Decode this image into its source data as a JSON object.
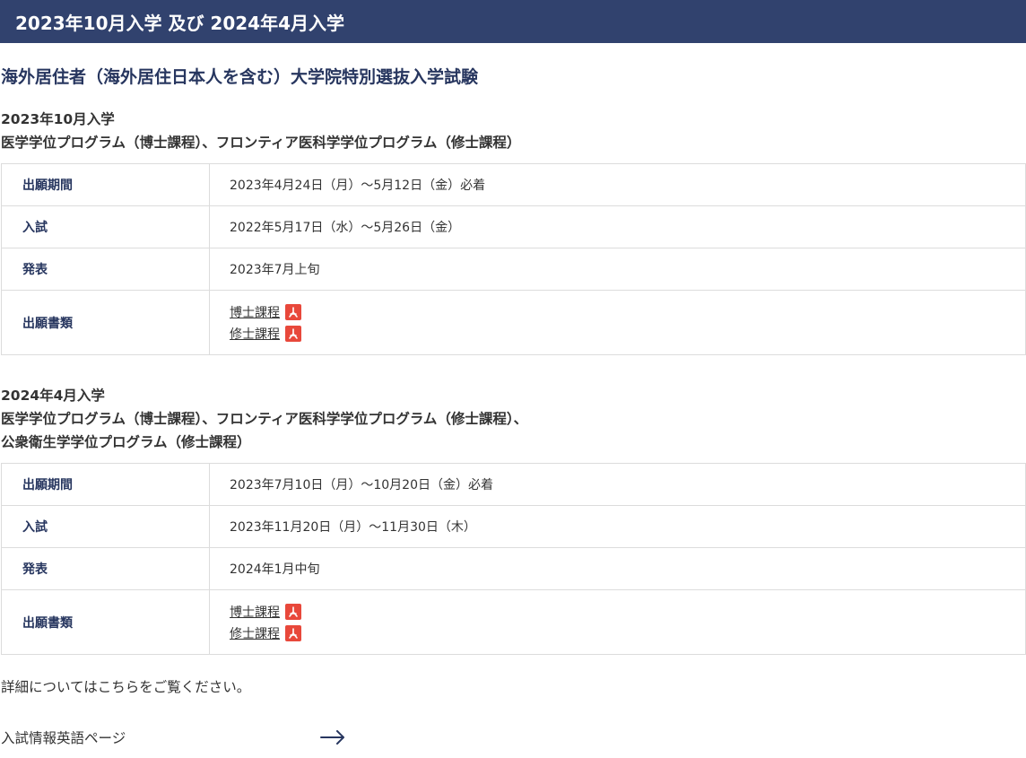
{
  "banner": {
    "title": "2023年10月入学 及び 2024年4月入学"
  },
  "main_heading": "海外居住者（海外居住日本人を含む）大学院特別選抜入学試験",
  "sections": [
    {
      "intake": "2023年10月入学",
      "programs": [
        "医学学位プログラム（博士課程）、フロンティア医科学学位プログラム（修士課程）"
      ],
      "rows": {
        "application_period": {
          "label": "出願期間",
          "value": "2023年4月24日（月）～5月12日（金）必着"
        },
        "exam": {
          "label": "入試",
          "value": "2022年5月17日（水）～5月26日（金）"
        },
        "announcement": {
          "label": "発表",
          "value": "2023年7月上旬"
        },
        "documents": {
          "label": "出願書類",
          "links": [
            "博士課程",
            "修士課程"
          ]
        }
      }
    },
    {
      "intake": "2024年4月入学",
      "programs": [
        "医学学位プログラム（博士課程）、フロンティア医科学学位プログラム（修士課程）、",
        "公衆衛生学学位プログラム（修士課程）"
      ],
      "rows": {
        "application_period": {
          "label": "出願期間",
          "value": "2023年7月10日（月）～10月20日（金）必着"
        },
        "exam": {
          "label": "入試",
          "value": "2023年11月20日（月）～11月30日（木）"
        },
        "announcement": {
          "label": "発表",
          "value": "2024年1月中旬"
        },
        "documents": {
          "label": "出願書類",
          "links": [
            "博士課程",
            "修士課程"
          ]
        }
      }
    }
  ],
  "footer": {
    "detail_text": "詳細についてはこちらをご覧ください。",
    "english_link": "入試情報英語ページ"
  },
  "icons": {
    "pdf": "pdf-icon",
    "arrow": "arrow-right-icon"
  },
  "colors": {
    "banner_bg": "#31426e",
    "heading": "#27365f",
    "pdf_red": "#e8483b"
  }
}
